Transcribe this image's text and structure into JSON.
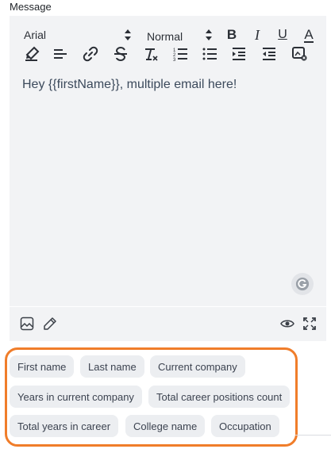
{
  "message_label": "Message",
  "toolbar": {
    "font": "Arial",
    "size": "Normal",
    "bold": "B",
    "italic": "I",
    "underline": "U",
    "font_color": "A"
  },
  "editor": {
    "content": "Hey {{firstName}}, multiple email here!"
  },
  "chips": [
    "First name",
    "Last name",
    "Current company",
    "Years in current company",
    "Total career positions count",
    "Total years in career",
    "College name",
    "Occupation"
  ],
  "colors": {
    "editor_bg": "#f2f3f5",
    "chip_bg": "#eceef1",
    "highlight_border": "#f07d2a",
    "text": "#3c4a5c"
  },
  "icons": {
    "footer_left": [
      "image-icon",
      "pencil-icon"
    ],
    "footer_right": [
      "preview-eye-icon",
      "fullscreen-icon"
    ],
    "grammarly": "grammarly-icon"
  }
}
